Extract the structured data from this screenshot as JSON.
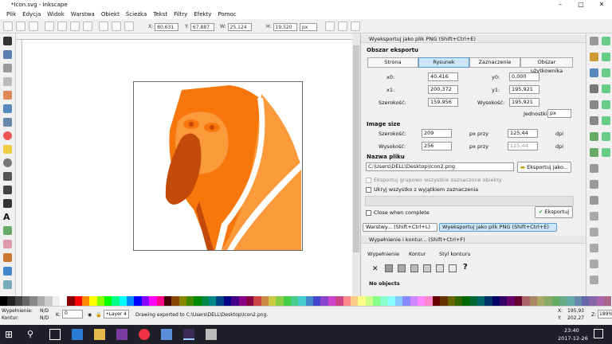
{
  "window": {
    "title": "*Icon.svg - Inkscape"
  },
  "menu": [
    "Plik",
    "Edycja",
    "Widok",
    "Warstwa",
    "Obiekt",
    "Ścieżka",
    "Tekst",
    "Filtry",
    "Efekty",
    "Pomoc"
  ],
  "coords": {
    "x_label": "X:",
    "x_value": "80,631",
    "y_label": "Y:",
    "y_value": "67,887",
    "w_label": "W:",
    "w_value": "25,124",
    "h_label": "H:",
    "h_value": "19,520",
    "unit": "px"
  },
  "export": {
    "title": "Wyeksportuj jako plik PNG (Shift+Ctrl+E)",
    "area_title": "Obszar eksportu",
    "tabs": [
      "Strona",
      "Rysunek",
      "Zaznaczenie",
      "Obszar użytkownika"
    ],
    "x0_label": "x0:",
    "x0": "40,416",
    "y0_label": "y0:",
    "y0": "0,000",
    "x1_label": "x1:",
    "x1": "200,372",
    "y1_label": "y1:",
    "y1": "195,921",
    "width_label": "Szerokość:",
    "width": "159,956",
    "height_label": "Wysokość:",
    "height": "195,921",
    "units_label": "Jednostki:",
    "units": "px",
    "image_size_title": "Image size",
    "img_width_label": "Szerokość:",
    "img_width": "209",
    "img_height_label": "Wysokość:",
    "img_height": "256",
    "px_at": "px przy",
    "dpi_x": "125,44",
    "dpi_y": "125,44",
    "dpi": "dpi",
    "filename_title": "Nazwa pliku",
    "filename": "C:\\Users\\DELL\\Desktop\\Icon2.png",
    "export_as_btn": "Eksportuj jako...",
    "batch_label": "Eksportuj grupowo wszystkie zaznaczone obiekty",
    "hide_label": "Ukryj wszystko z wyjątkiem zaznaczenia",
    "close_label": "Close when complete",
    "export_btn": "Eksportuj"
  },
  "docked_tabs": {
    "layers": "Warstwy... (Shift+Ctrl+L)",
    "export": "Wyeksportuj jako plik PNG (Shift+Ctrl+E)"
  },
  "fill": {
    "title": "Wypełnienie i kontur... (Shift+Ctrl+F)",
    "tabs": [
      "Wypełnienie",
      "Kontur",
      "Styl konturu"
    ],
    "no_objects": "No objects"
  },
  "status": {
    "fill_label": "Wypełnienie:",
    "fill_value": "N/D",
    "stroke_label": "Kontur:",
    "stroke_value": "N/D",
    "opacity_label": "K:",
    "opacity_value": "0",
    "layer": "•Layer 4",
    "message": "Drawing exported to C:\\Users\\DELL\\Desktop\\Icon2.png.",
    "x_label": "X:",
    "x_value": "195,93",
    "y_label": "Y:",
    "y_value": "202,27",
    "zoom_label": "Z:",
    "zoom": "189%"
  },
  "taskbar": {
    "time": "23:40",
    "date": "2017-12-26"
  },
  "colors": {
    "accent_orange": "#f7770d",
    "light_orange": "#fb9a3b",
    "dark_orange": "#c24a0a",
    "selection_blue": "#cde6f7"
  }
}
